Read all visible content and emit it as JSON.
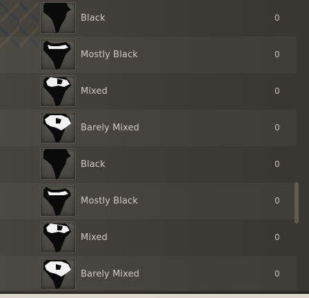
{
  "items": [
    {
      "label": "Black",
      "count": "0",
      "icon": "africa-map-icon"
    },
    {
      "label": "Mostly Black",
      "count": "0",
      "icon": "africa-map-icon"
    },
    {
      "label": "Mixed",
      "count": "0",
      "icon": "africa-map-icon"
    },
    {
      "label": "Barely Mixed",
      "count": "0",
      "icon": "africa-map-icon"
    },
    {
      "label": "Black",
      "count": "0",
      "icon": "africa-map-icon"
    },
    {
      "label": "Mostly Black",
      "count": "0",
      "icon": "africa-map-icon"
    },
    {
      "label": "Mixed",
      "count": "0",
      "icon": "africa-map-icon"
    },
    {
      "label": "Barely Mixed",
      "count": "0",
      "icon": "africa-map-icon"
    }
  ],
  "colors": {
    "panel": "#3e3b36",
    "text": "#cfcac0",
    "icon_dark": "#0a0a0a",
    "icon_light": "#f2f2f2",
    "icon_bg": "#5a5a52"
  }
}
